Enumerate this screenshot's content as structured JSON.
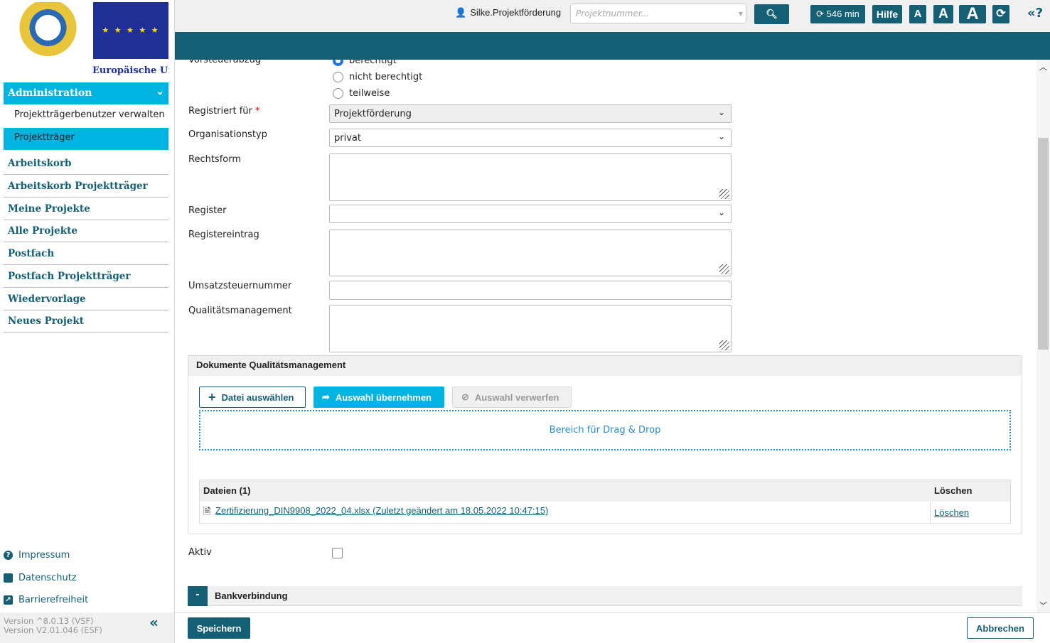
{
  "header": {
    "user": "Silke.Projektförderung",
    "search_placeholder": "Projektnummer...",
    "session": "546 min",
    "help": "Hilfe",
    "font_small": "A",
    "font_medium": "A",
    "font_large": "A",
    "toggle": "«?"
  },
  "sidebar": {
    "logo_caption": "Europäische Uni",
    "section": "Administration",
    "sub_items": [
      "Projektträgerbenutzer verwalten",
      "Projektträger"
    ],
    "items": [
      "Arbeitskorb",
      "Arbeitskorb Projektträger",
      "Meine Projekte",
      "Alle Projekte",
      "Postfach",
      "Postfach Projektträger",
      "Wiedervorlage",
      "Neues Projekt"
    ],
    "footer_links": [
      "Impressum",
      "Datenschutz",
      "Barrierefreiheit"
    ],
    "versions": [
      "Version ^8.0.13 (VSF)",
      "Version V2.01.046 (ESF)"
    ]
  },
  "form": {
    "vorsteuer_label": "Vorsteuerabzug *",
    "vorsteuer_options": [
      "berechtigt",
      "nicht berechtigt",
      "teilweise"
    ],
    "vorsteuer_selected": "berechtigt",
    "registriert_label": "Registriert für",
    "registriert_value": "Projektförderung",
    "orgtyp_label": "Organisationstyp",
    "orgtyp_value": "privat",
    "rechtsform_label": "Rechtsform",
    "register_label": "Register",
    "registereintrag_label": "Registereintrag",
    "ust_label": "Umsatzsteuernummer",
    "qm_label": "Qualitätsmanagement",
    "docs": {
      "title": "Dokumente Qualitätsmanagement",
      "choose": "Datei auswählen",
      "accept": "Auswahl übernehmen",
      "discard": "Auswahl verwerfen",
      "dropzone": "Bereich für Drag & Drop",
      "files_header": "Dateien (1)",
      "delete_header": "Löschen",
      "files": [
        {
          "name": "Zertifizierung_DIN9908_2022_04.xlsx (Zuletzt geändert am 18.05.2022 10:47:15)",
          "delete": "Löschen"
        }
      ]
    },
    "aktiv_label": "Aktiv",
    "aktiv_checked": false,
    "bank_title": "Bankverbindung",
    "bank_toggle": "-"
  },
  "footer": {
    "save": "Speichern",
    "cancel": "Abbrechen"
  },
  "colors": {
    "primary": "#155f75",
    "accent": "#00b4e1"
  }
}
